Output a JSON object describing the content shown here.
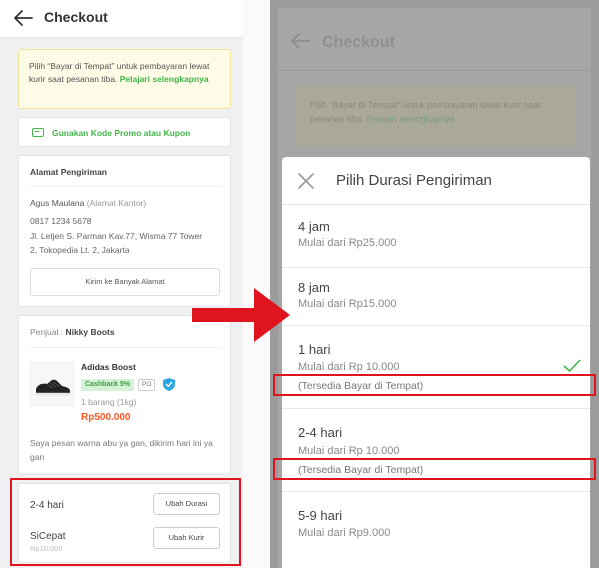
{
  "left": {
    "header": {
      "title": "Checkout"
    },
    "notice": {
      "text": "Pilih “Bayar di Tempat” untuk pembayaran lewat kurir saat pesanan tiba.",
      "link": "Pelajari selengkapnya"
    },
    "promo": {
      "label": "Gunakan Kode Promo atau Kupon"
    },
    "address": {
      "title": "Alamat Pengiriman",
      "name": "Agus Maulana",
      "label": "(Alamat Kantor)",
      "phone": "0817 1234 5678",
      "line1": "Jl. Letjen S. Parman Kav.77, Wisma 77 Tower",
      "line2": "2, Tokopedia Lt. 2, Jakarta",
      "button": "Kirim ke Banyak Alamat"
    },
    "order": {
      "seller_prefix": "Penjual : ",
      "seller_name": "Nikky Boots",
      "product_name": "Adidas Boost",
      "cashback": "Cashback 5%",
      "po_badge": "PO",
      "quantity": "1 barang (1kg)",
      "price": "Rp500.000",
      "note": "Saya pesan warna abu ya gan, dikirim hari ini ya gan"
    },
    "shipping": {
      "duration": "2-4 hari",
      "change_duration_button": "Ubah Durasi",
      "courier": "SiCepat",
      "courier_price": "Rp10.000",
      "change_courier_button": "Ubah Kurir"
    }
  },
  "right": {
    "background": {
      "title": "Checkout",
      "notice_text": "Pilih “Bayar di Tempat” untuk pembayaran lewat kurir saat pesanan tiba.",
      "notice_link": "Pelajari selengkapnya"
    },
    "sheet": {
      "title": "Pilih Durasi Pengiriman",
      "options": [
        {
          "label": "4 jam",
          "price": "Mulai dari Rp25.000",
          "cod": "",
          "selected": false
        },
        {
          "label": "8 jam",
          "price": "Mulai dari Rp15.000",
          "cod": "",
          "selected": false
        },
        {
          "label": "1 hari",
          "price": "Mulai dari Rp 10.000",
          "cod": "(Tersedia Bayar di Tempat)",
          "selected": true
        },
        {
          "label": "2-4 hari",
          "price": "Mulai dari Rp 10.000",
          "cod": "(Tersedia Bayar di Tempat)",
          "selected": false
        },
        {
          "label": "5-9 hari",
          "price": "Mulai dari Rp9.000",
          "cod": "",
          "selected": false
        }
      ]
    }
  },
  "colors": {
    "accent_green": "#42b549",
    "price_orange": "#ff5722",
    "highlight_red": "#e0141f"
  }
}
